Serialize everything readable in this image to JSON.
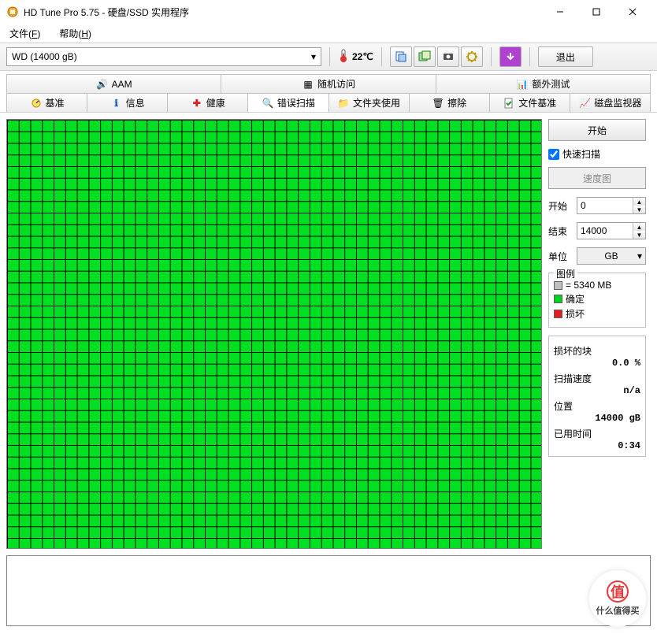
{
  "window": {
    "title": "HD Tune Pro 5.75 - 硬盘/SSD 实用程序"
  },
  "menu": {
    "file": "文件",
    "file_hotkey": "F",
    "help": "帮助",
    "help_hotkey": "H"
  },
  "toolbar": {
    "drive_label": "WD                (14000 gB)",
    "temperature": "22℃",
    "exit_label": "退出"
  },
  "tabs_top": {
    "aam": "AAM",
    "random": "随机访问",
    "extra": "额外测试"
  },
  "tabs_bottom": {
    "benchmark": "基准",
    "info": "信息",
    "health": "健康",
    "error_scan": "错误扫描",
    "folder_usage": "文件夹使用",
    "erase": "擦除",
    "file_benchmark": "文件基准",
    "disk_monitor": "磁盘监视器"
  },
  "side": {
    "start_btn": "开始",
    "quick_scan": "快速扫描",
    "speed_map": "速度图",
    "start_label": "开始",
    "start_value": "0",
    "end_label": "结束",
    "end_value": "14000",
    "unit_label": "单位",
    "unit_value": "GB"
  },
  "legend": {
    "title": "图例",
    "block_size": "= 5340 MB",
    "ok": "确定",
    "damaged": "损坏"
  },
  "stats": {
    "damaged_blocks_label": "损坏的块",
    "damaged_blocks_value": "0.0 %",
    "scan_speed_label": "扫描速度",
    "scan_speed_value": "n/a",
    "position_label": "位置",
    "position_value": "14000 gB",
    "elapsed_label": "已用时间",
    "elapsed_value": "0:34"
  },
  "watermark": {
    "char": "值",
    "text": "什么值得买"
  }
}
